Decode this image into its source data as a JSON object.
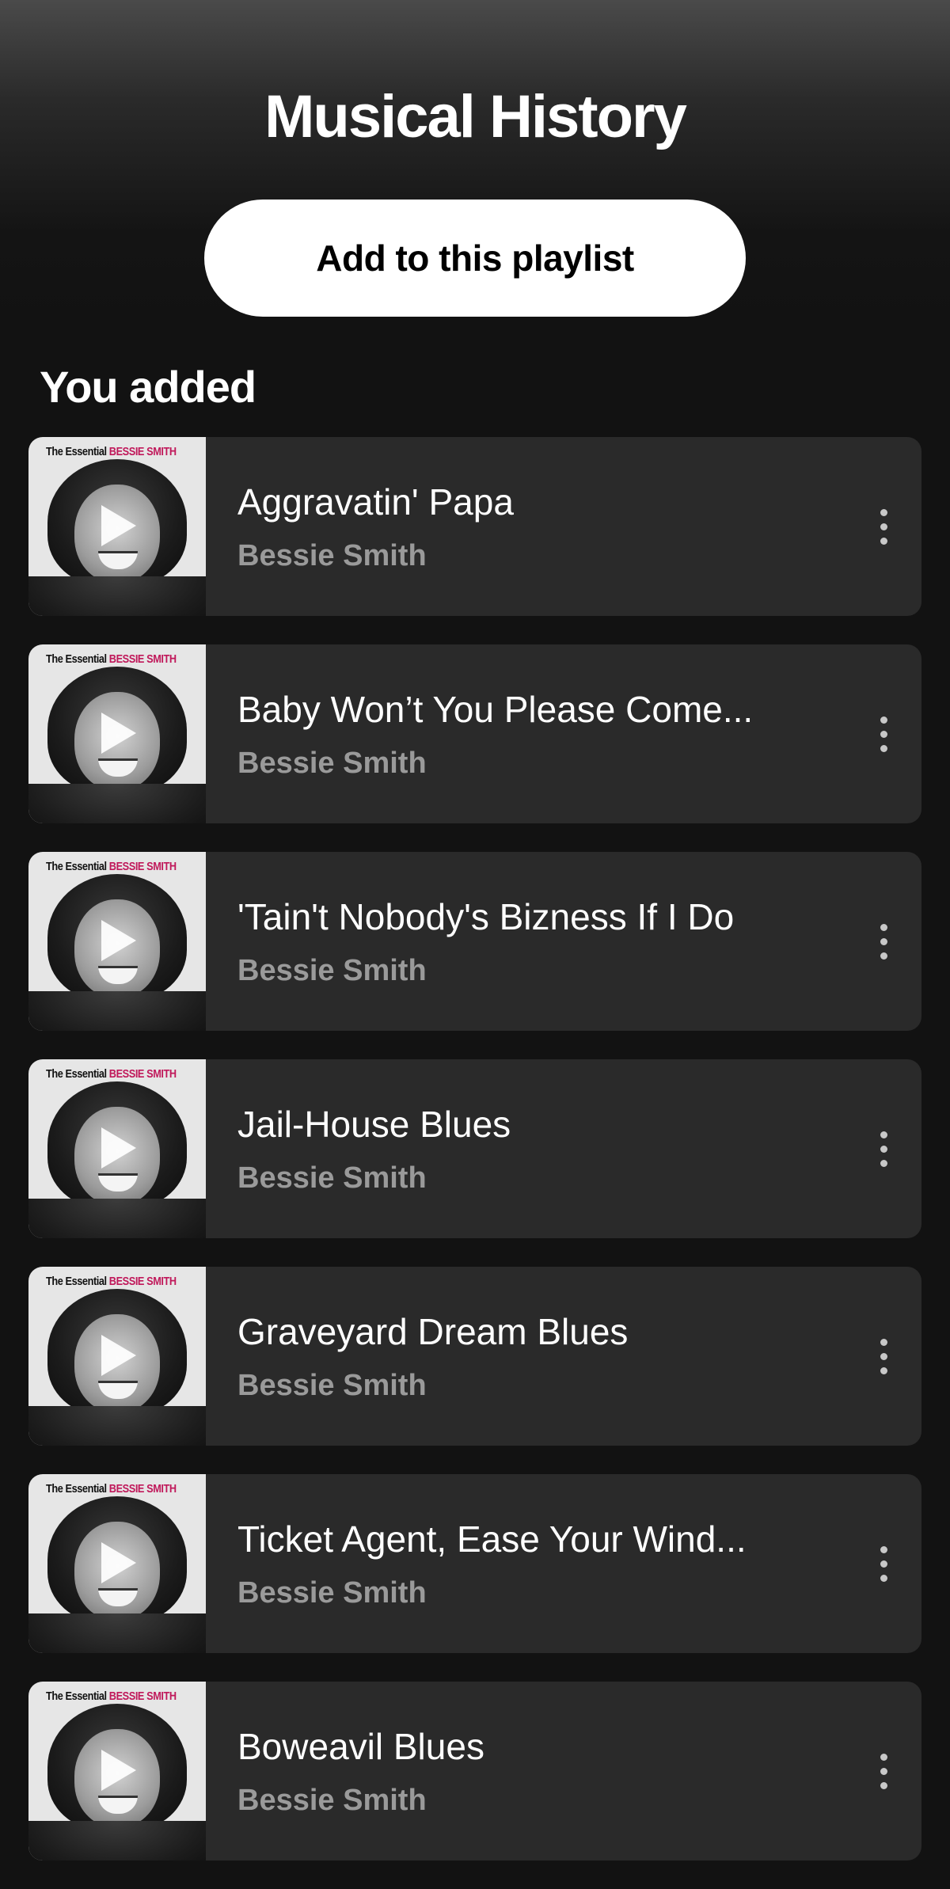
{
  "header": {
    "title": "Musical History",
    "add_button_label": "Add to this playlist"
  },
  "section": {
    "heading": "You added"
  },
  "tracks": [
    {
      "title": "Aggravatin' Papa",
      "artist": "Bessie Smith"
    },
    {
      "title": "Baby Won’t You Please Come...",
      "artist": "Bessie Smith"
    },
    {
      "title": "'Tain't Nobody's Bizness If I Do",
      "artist": "Bessie Smith"
    },
    {
      "title": "Jail-House Blues",
      "artist": "Bessie Smith"
    },
    {
      "title": "Graveyard Dream Blues",
      "artist": "Bessie Smith"
    },
    {
      "title": "Ticket Agent, Ease Your Wind...",
      "artist": "Bessie Smith"
    },
    {
      "title": "Boweavil Blues",
      "artist": "Bessie Smith"
    }
  ],
  "album_art": {
    "caption_prefix": "The Essential",
    "caption_name": "BESSIE SMITH"
  },
  "icons": {
    "play": "play-icon",
    "more": "more-options-icon"
  },
  "colors": {
    "background": "#121212",
    "row_background": "#2a2a2a",
    "primary_text": "#ffffff",
    "secondary_text": "#9a9a9a",
    "button_background": "#ffffff",
    "cover_accent": "#c0185a"
  }
}
